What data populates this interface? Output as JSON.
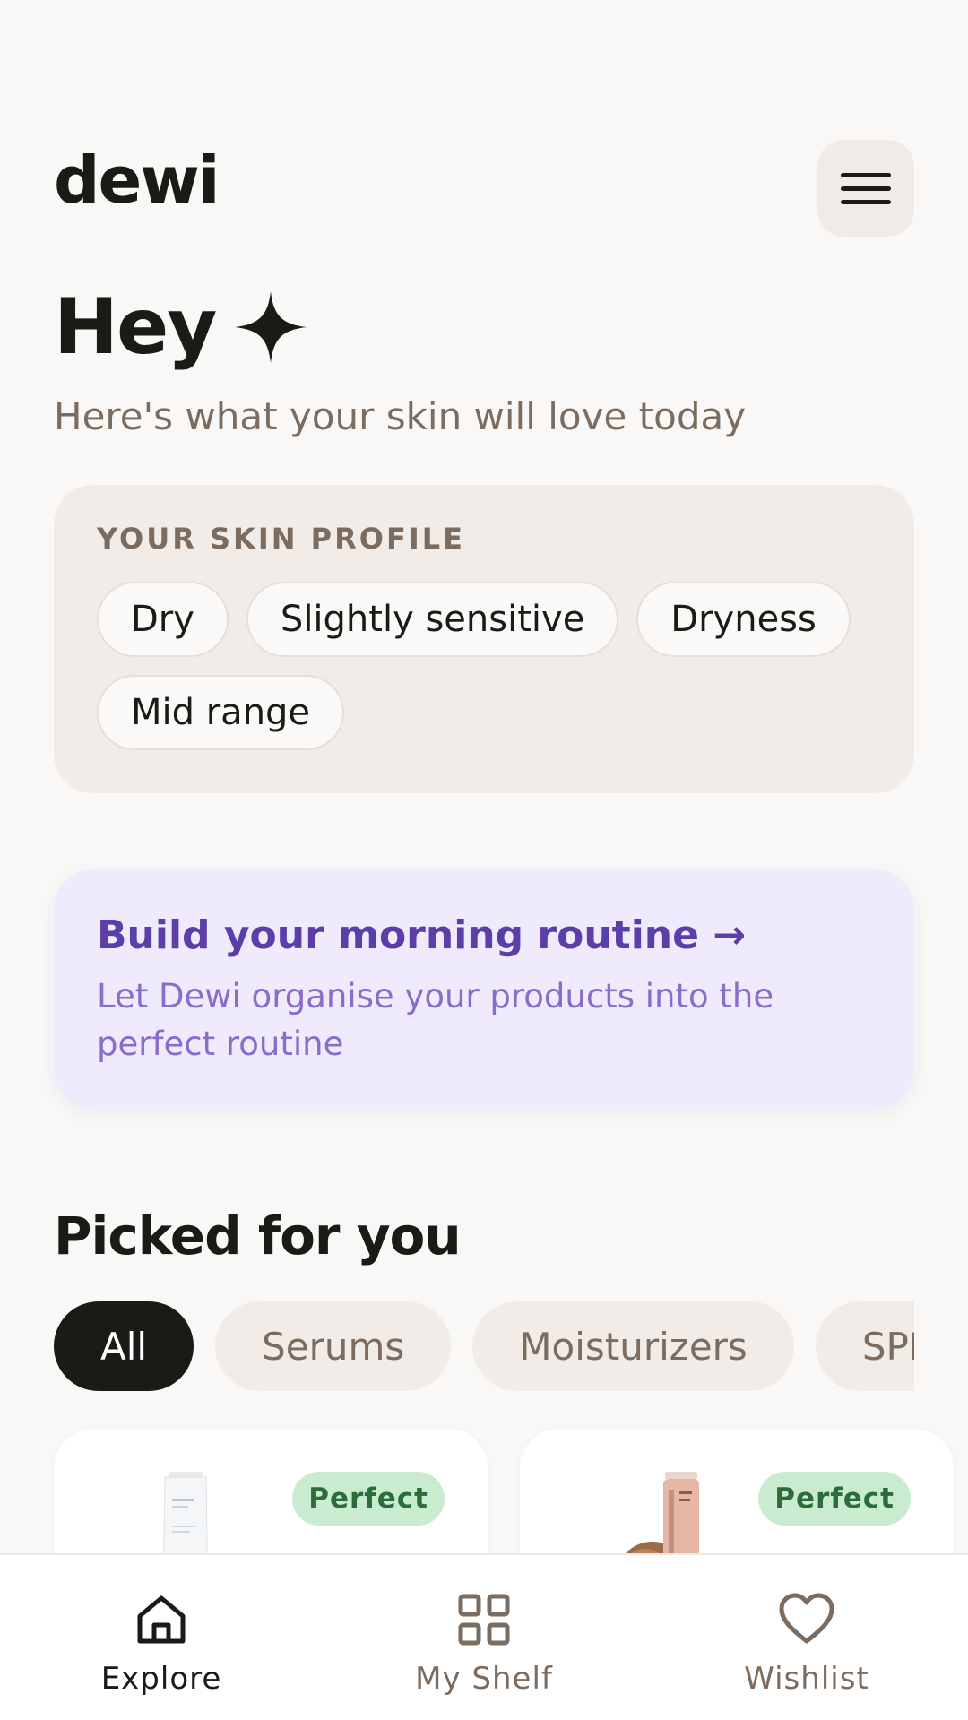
{
  "app": {
    "name": "dewi"
  },
  "header": {
    "greeting": "Hey",
    "subtitle": "Here's what your skin will love today"
  },
  "skin_profile": {
    "label": "YOUR SKIN PROFILE",
    "tags": [
      "Dry",
      "Slightly sensitive",
      "Dryness",
      "Mid range"
    ]
  },
  "routine_banner": {
    "title": "Build your morning routine →",
    "description": "Let Dewi organise your products into the perfect routine"
  },
  "picks": {
    "title": "Picked for you",
    "filters": [
      "All",
      "Serums",
      "Moisturizers",
      "SPF"
    ],
    "active_filter": "All",
    "cards": [
      {
        "badge": "Perfect"
      },
      {
        "badge": "Perfect"
      }
    ]
  },
  "bottom_nav": {
    "items": [
      {
        "label": "Explore",
        "icon": "home-icon",
        "active": true
      },
      {
        "label": "My Shelf",
        "icon": "grid-icon",
        "active": false
      },
      {
        "label": "Wishlist",
        "icon": "heart-icon",
        "active": false
      }
    ]
  },
  "colors": {
    "background": "#f9f8f6",
    "accent_purple": "#5b3ea7",
    "badge_green": "#c9ecd1",
    "chip_bg": "#f1ece7",
    "text_dark": "#1c1a17",
    "text_muted": "#7b6c5f"
  }
}
